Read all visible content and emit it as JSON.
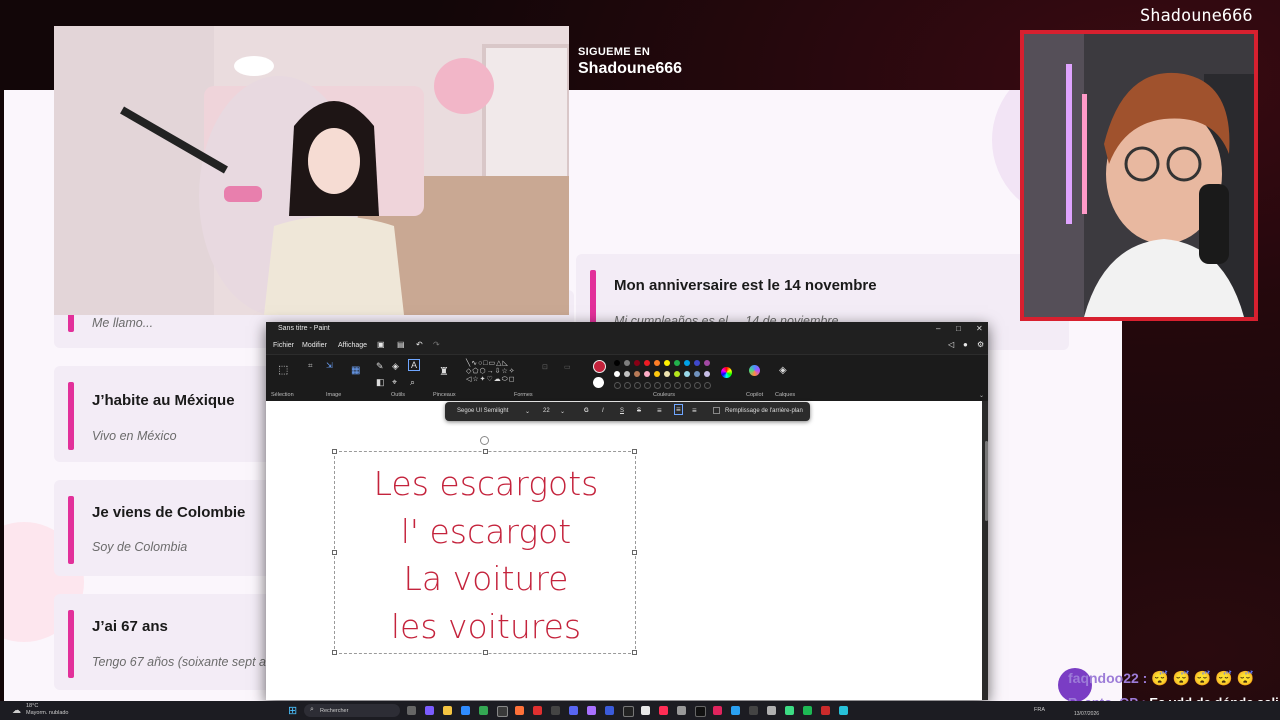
{
  "stream": {
    "follow_label": "SIGUEME EN",
    "follow_name": "Shadoune666",
    "cam_name": "Shadoune666"
  },
  "slide": {
    "cards": [
      {
        "title": "",
        "subtitle": "Me llamo..."
      },
      {
        "title": "J’habite au Méxique",
        "subtitle": "Vivo en México"
      },
      {
        "title": "Je viens de Colombie",
        "subtitle": "Soy de Colombia"
      },
      {
        "title": "J’ai 67 ans",
        "subtitle": "Tengo 67 años (soixante sept a"
      },
      {
        "title": "Mon anniversaire est le 14 novembre",
        "subtitle": "Mi cumpleaños es el ... 14 de noviembre"
      }
    ]
  },
  "paint": {
    "window_title": "Sans titre - Paint",
    "menu": [
      "Fichier",
      "Modifier",
      "Affichage"
    ],
    "ribbon_labels": [
      "Sélection",
      "Image",
      "Outils",
      "Pinceaux",
      "Formes",
      "Couleurs",
      "Copilot",
      "Calques"
    ],
    "text_toolbar": {
      "font": "Segoe UI Semilight",
      "size": "22",
      "bold": "G",
      "italic": "I",
      "underline": "S",
      "strike": "S",
      "fill_label": "Remplissage de l'arrière-plan"
    },
    "canvas_text": [
      "Les escargots",
      "l' escargot",
      "La voiture",
      "les voitures"
    ],
    "text_color": "#c4233c"
  },
  "chat": [
    {
      "user": "faqndoo22 :",
      "message": "😴 😴 😴 😴 😴",
      "badge": "4"
    },
    {
      "user": "R_anto_OP :",
      "message": "Es vdd de dónde sali"
    }
  ],
  "taskbar": {
    "weather_temp": "18°C",
    "weather_desc": "Mayorm. nublado",
    "search_placeholder": "Rechercher",
    "lang": "FRA",
    "date": "13/07/2026"
  }
}
